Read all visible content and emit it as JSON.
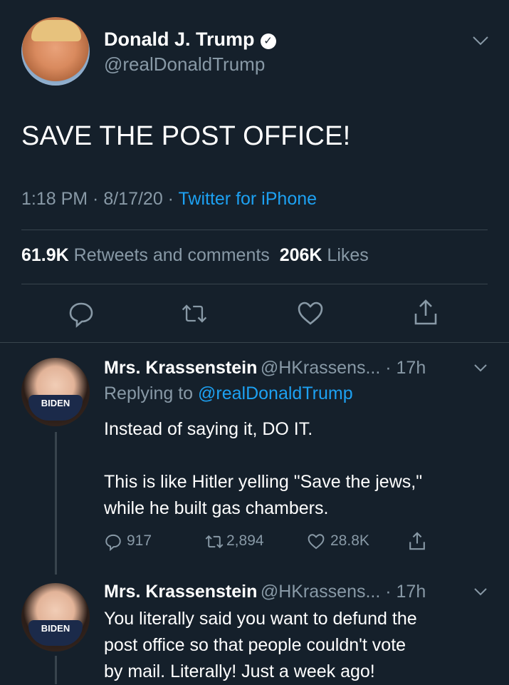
{
  "tweet": {
    "author_name": "Donald J. Trump",
    "verified_mark": "✓",
    "handle": "@realDonaldTrump",
    "text": "SAVE THE POST OFFICE!",
    "time": "1:18 PM · 8/17/20 · ",
    "source": "Twitter for iPhone",
    "retweets_count": "61.9K",
    "retweets_label": "Retweets and comments",
    "likes_count": "206K",
    "likes_label": "Likes",
    "actions": [
      "reply-icon",
      "retweet-icon",
      "like-icon",
      "share-icon"
    ]
  },
  "replies": [
    {
      "author_name": "Mrs. Krassenstein",
      "handle_time": "@HKrassens... · 17h",
      "replying_prefix": "Replying to ",
      "replying_handle": "@realDonaldTrump",
      "text_line1": "Instead of saying it, DO IT.",
      "text_line2": "This is like Hitler yelling \"Save the jews,\"",
      "text_line3": "while he built gas chambers.",
      "mask_text": "BIDEN",
      "reply_count": "917",
      "retweet_count": "2,894",
      "like_count": "28.8K"
    },
    {
      "author_name": "Mrs. Krassenstein",
      "handle_time": "@HKrassens... · 17h",
      "text_line1": "You literally said you want to defund the",
      "text_line2": "post office so that people couldn't vote",
      "text_line3": "by mail.  Literally!  Just a week ago!",
      "mask_text": "BIDEN"
    }
  ],
  "colors": {
    "background": "#15202b",
    "accent": "#1da1f2",
    "muted": "#8899a6",
    "divider": "#38444d"
  }
}
